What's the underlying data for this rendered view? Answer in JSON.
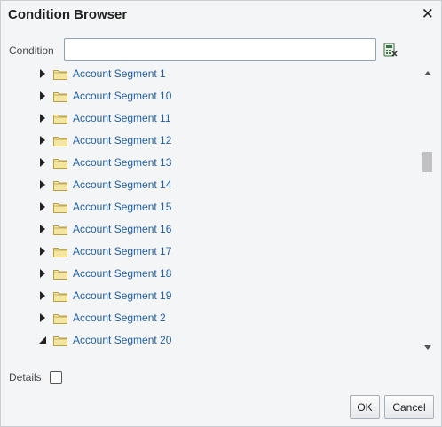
{
  "dialog": {
    "title": "Condition Browser",
    "close_symbol": "✕"
  },
  "condition": {
    "label": "Condition",
    "value": "",
    "placeholder": ""
  },
  "tree": {
    "items": [
      {
        "label": "Account Segment 1",
        "expanded": false
      },
      {
        "label": "Account Segment 10",
        "expanded": false
      },
      {
        "label": "Account Segment 11",
        "expanded": false
      },
      {
        "label": "Account Segment 12",
        "expanded": false
      },
      {
        "label": "Account Segment 13",
        "expanded": false
      },
      {
        "label": "Account Segment 14",
        "expanded": false
      },
      {
        "label": "Account Segment 15",
        "expanded": false
      },
      {
        "label": "Account Segment 16",
        "expanded": false
      },
      {
        "label": "Account Segment 17",
        "expanded": false
      },
      {
        "label": "Account Segment 18",
        "expanded": false
      },
      {
        "label": "Account Segment 19",
        "expanded": false
      },
      {
        "label": "Account Segment 2",
        "expanded": false
      },
      {
        "label": "Account Segment 20",
        "expanded": true
      }
    ]
  },
  "details": {
    "label": "Details",
    "checked": false
  },
  "buttons": {
    "ok": "OK",
    "cancel": "Cancel"
  },
  "icons": {
    "calculator": "calculator-icon",
    "folder": "folder-icon",
    "close": "close-icon"
  },
  "colors": {
    "link": "#1f5fa6",
    "folder_fill": "#f3e6a3",
    "folder_stroke": "#b8a14a"
  }
}
